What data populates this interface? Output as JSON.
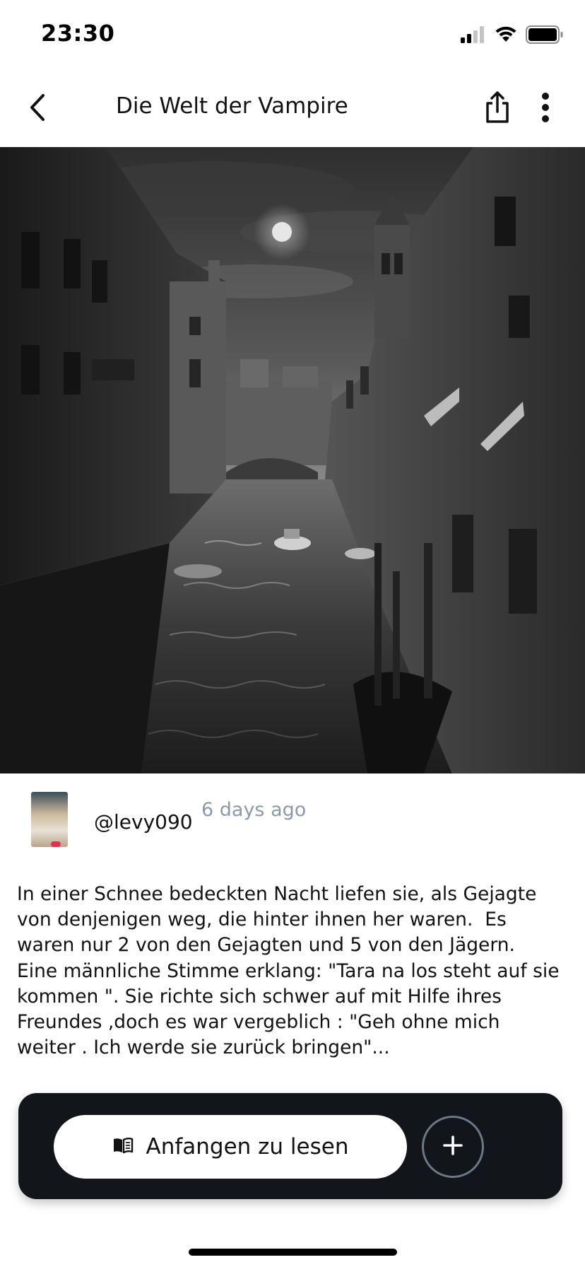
{
  "status_bar": {
    "time": "23:30",
    "icons": [
      "signal-icon",
      "wifi-icon",
      "battery-icon"
    ]
  },
  "nav": {
    "title": "Die Welt der Vampire",
    "icons": [
      "back-icon",
      "share-icon",
      "more-icon"
    ]
  },
  "cover": {
    "icon": "cover-image",
    "description_hidden": false
  },
  "author": {
    "handle": "@levy090",
    "posted": "6 days ago"
  },
  "story": {
    "excerpt": "In einer Schnee bedeckten Nacht liefen sie, als Gejagte\nvon denjenigen weg, die hinter ihnen her waren.  Es\nwaren nur 2 von den Gejagten und 5 von den Jägern.\nEine männliche Stimme erklang: \"Tara na los steht auf sie\nkommen \". Sie richte sich schwer auf mit Hilfe ihres\nFreundes ,doch es war vergeblich : \"Geh ohne mich\nweiter . Ich werde sie zurück bringen\"..."
  },
  "actions": {
    "read_label": "Anfangen zu lesen",
    "read_icon": "book-icon",
    "add_icon": "plus-icon"
  },
  "colors": {
    "panel": "#121519",
    "muted": "#8a9aaa",
    "badge": "#e2314d"
  }
}
